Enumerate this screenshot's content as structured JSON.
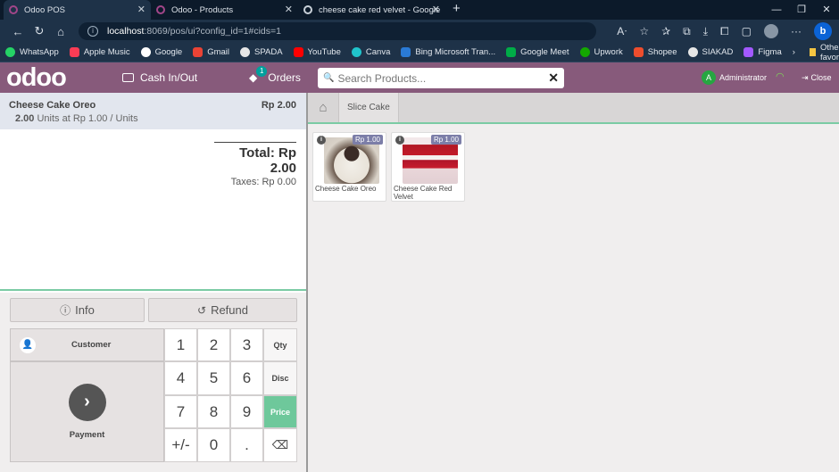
{
  "browser": {
    "tabs": [
      {
        "title": "Odoo POS",
        "active": true
      },
      {
        "title": "Odoo - Products",
        "active": false
      },
      {
        "title": "cheese cake red velvet - Google",
        "active": false
      }
    ],
    "url_host": "localhost",
    "url_rest": ":8069/pos/ui?config_id=1#cids=1",
    "bookmarks": [
      "WhatsApp",
      "Apple Music",
      "Google",
      "Gmail",
      "SPADA",
      "YouTube",
      "Canva",
      "Bing Microsoft Tran...",
      "Google Meet",
      "Upwork",
      "Shopee",
      "SIAKAD",
      "Figma"
    ],
    "other_favorites": "Other favorites"
  },
  "header": {
    "logo": "odoo",
    "cash_label": "Cash In/Out",
    "orders_label": "Orders",
    "orders_count": "1",
    "search_placeholder": "Search Products...",
    "user_initial": "A",
    "user_name": "Administrator",
    "close_label": "Close"
  },
  "order": {
    "line": {
      "name": "Cheese Cake Oreo",
      "price": "Rp 2.00",
      "qty": "2.00",
      "qty_text": " Units at Rp 1.00 / Units"
    },
    "total": "Total: Rp 2.00",
    "taxes": "Taxes: Rp 0.00"
  },
  "controls": {
    "info_label": "Info",
    "refund_label": "Refund",
    "customer_label": "Customer",
    "payment_label": "Payment",
    "keys": [
      "1",
      "2",
      "3",
      "Qty",
      "4",
      "5",
      "6",
      "Disc",
      "7",
      "8",
      "9",
      "Price",
      "+/-",
      "0",
      ".",
      "⌫"
    ],
    "selected_mode": "Price"
  },
  "categories": {
    "crumb": "Slice Cake"
  },
  "products": [
    {
      "name": "Cheese Cake Oreo",
      "price": "Rp 1.00"
    },
    {
      "name": "Cheese Cake Red Velvet",
      "price": "Rp 1.00"
    }
  ],
  "colors": {
    "brand": "#875a7b",
    "accent": "#6ec89b",
    "browser_bg": "#1e3248"
  }
}
